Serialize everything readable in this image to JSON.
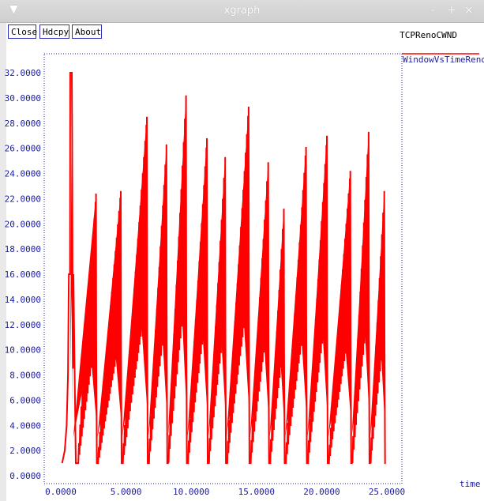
{
  "window": {
    "title": "xgraph",
    "controls": {
      "minimize": "–",
      "maximize": "+",
      "close": "×"
    }
  },
  "toolbar": {
    "close_label": "Close",
    "hdcpy_label": "Hdcpy",
    "about_label": "About"
  },
  "colors": {
    "series": "#ff0000",
    "axis": "#1a1aa0"
  },
  "chart_data": {
    "type": "line",
    "title": "TCPRenoCWND",
    "xlabel": "time",
    "ylabel": "",
    "xlim": [
      0,
      25
    ],
    "ylim": [
      0,
      32
    ],
    "xticks": [
      "0.0000",
      "5.0000",
      "10.0000",
      "15.0000",
      "20.0000",
      "25.0000"
    ],
    "yticks": [
      "0.0000",
      "2.0000",
      "4.0000",
      "6.0000",
      "8.0000",
      "10.0000",
      "12.0000",
      "14.0000",
      "16.0000",
      "18.0000",
      "20.0000",
      "22.0000",
      "24.0000",
      "26.0000",
      "28.0000",
      "30.0000",
      "32.0000"
    ],
    "grid": false,
    "legend_position": "top-right",
    "series": [
      {
        "name": "WindowVsTimeReno",
        "peaks": [
          {
            "t": 0.85,
            "peak": 32.0,
            "trough": 8.5
          },
          {
            "t": 2.7,
            "peak": 22.4,
            "trough": 1.0
          },
          {
            "t": 4.6,
            "peak": 22.6,
            "trough": 1.0
          },
          {
            "t": 6.6,
            "peak": 28.5,
            "trough": 1.0
          },
          {
            "t": 8.1,
            "peak": 26.3,
            "trough": 1.0
          },
          {
            "t": 9.6,
            "peak": 30.2,
            "trough": 1.0
          },
          {
            "t": 11.2,
            "peak": 26.8,
            "trough": 1.0
          },
          {
            "t": 12.6,
            "peak": 25.3,
            "trough": 1.0
          },
          {
            "t": 14.4,
            "peak": 29.3,
            "trough": 1.0
          },
          {
            "t": 15.9,
            "peak": 24.9,
            "trough": 1.0
          },
          {
            "t": 17.1,
            "peak": 21.2,
            "trough": 1.0
          },
          {
            "t": 18.8,
            "peak": 26.1,
            "trough": 1.0
          },
          {
            "t": 20.4,
            "peak": 27.0,
            "trough": 1.0
          },
          {
            "t": 22.2,
            "peak": 24.2,
            "trough": 1.0
          },
          {
            "t": 23.6,
            "peak": 27.3,
            "trough": 1.0
          },
          {
            "t": 24.8,
            "peak": 22.6,
            "trough": 1.0
          }
        ]
      }
    ]
  }
}
